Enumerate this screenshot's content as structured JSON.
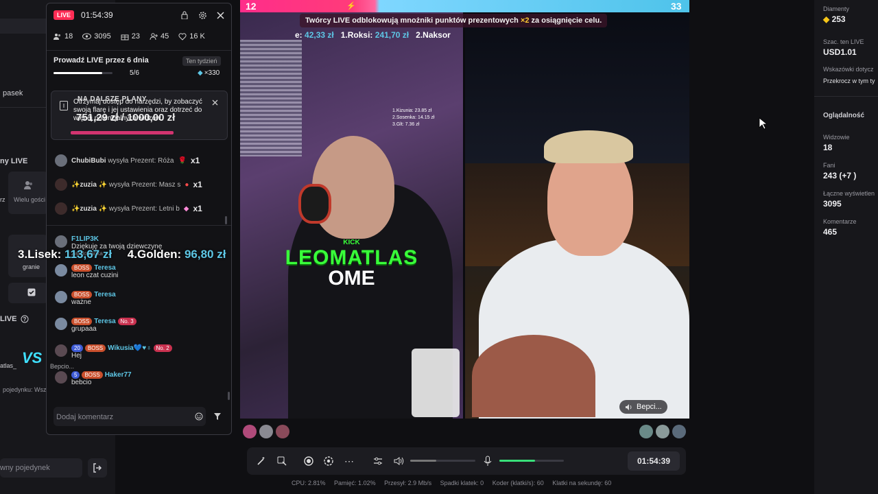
{
  "studio_left": {
    "label_pasek": "pasek",
    "label_live_small": "ny LIVE",
    "label_rz": "rz",
    "label_multi_guest": "Wielu gości",
    "label_granie": "granie",
    "label_live": "LIVE",
    "vs_name": "atlas_",
    "battle_gifts": "pojedynku: Wszystkie Prezenty",
    "battle_input": "wny pojedynek"
  },
  "chat": {
    "live_badge": "LIVE",
    "timer": "01:54:39",
    "stats": {
      "gifters": "18",
      "viewers": "3095",
      "gifts": "23",
      "followers": "45",
      "likes": "16 K"
    },
    "goal_title": "Prowadź LIVE przez 6 dnia",
    "goal_period": "Ten tydzień",
    "goal_progress_text": "5/6",
    "goal_progress": 0.83,
    "goal_reward": "×330",
    "notice_text": "Otrzymaj dostęp do narzędzi, by zobaczyć swoją flarę i jej ustawienia oraz dotrzeć do więcej potencjalnych widzów.",
    "overlay_plans": "NA DALSZE PLANY",
    "overlay_amount": "751,29 zł / 1000,00 zł",
    "messages": [
      {
        "user": "ChubiBubi",
        "text": "wysyła Prezent: Róża",
        "count": "x1"
      },
      {
        "user": "✨zuzia ✨",
        "text": "wysyła Prezent: Masz s",
        "count": "x1"
      },
      {
        "user": "✨zuzia ✨",
        "text": "wysyła Prezent: Letni b",
        "count": "x1"
      },
      {
        "user": "F1LIP3K",
        "text": "Dziękuję za twoją dziewczynę",
        "sub": "Zaadowanka"
      },
      {
        "user": "Teresa",
        "badge": "BOSS",
        "text": "leon czat cuzini"
      },
      {
        "user": "Teresa",
        "badge": "BOSS",
        "text": "ważne"
      },
      {
        "user": "Teresa",
        "badge": "BOSS",
        "rank": "No. 3",
        "text": "grupaaa"
      },
      {
        "user": "Wikusia💙♥︎♁",
        "level": "20",
        "badge": "BOSS",
        "rank": "No. 2",
        "text": "Hej"
      },
      {
        "user": "Haker77",
        "level": "5",
        "badge": "BOSS",
        "text": "bebcio",
        "sub": "Bepcio..."
      }
    ],
    "input_placeholder": "Dodaj komentarz"
  },
  "leaderboard_overlay": {
    "third_label": "3.Lisek:",
    "third_value": "113,67 zł",
    "fourth_label": "4.Golden:",
    "fourth_value": "96,80 zł"
  },
  "video": {
    "score_left": "12",
    "score_right": "33",
    "banner": "Twórcy LIVE odblokowują mnożniki punktów prezentowych",
    "banner_mult": "×2",
    "banner_end": "za osiągnięcie celu.",
    "ranking_line": {
      "a": "e:",
      "a_val": "42,33 zł",
      "b": "1.Roksi:",
      "b_val": "241,70 zł",
      "c": "2.Naksor"
    },
    "mini_rank": [
      "1.Kizunia: 23.85 zł",
      "2.Sosenka: 14.15 zł",
      "3.Glt: 7.36 zł"
    ],
    "kick_label": "KICK",
    "kick_name": "LEOMATLAS",
    "kick_sub": "OME",
    "guest_name": "Bepci..."
  },
  "controls": {
    "timer": "01:54:39",
    "volume": 0.4,
    "mic": 0.55
  },
  "status": {
    "cpu": "CPU: 2.81%",
    "memory": "Pamięć: 1.02%",
    "bitrate": "Przesył: 2.9 Mb/s",
    "dropped": "Spadki klatek: 0",
    "encoder": "Koder (klatki/s): 60",
    "fps": "Klatki na sekundę: 60"
  },
  "right_panel": {
    "diamonds_label": "Diamenty",
    "diamonds": "253",
    "est_label": "Szac. ten LIVE",
    "est": "USD1.01",
    "tips_label": "Wskazówki dotycz",
    "tips_text": "Przekrocz w tym ty",
    "viewership_title": "Oglądalność",
    "viewers_label": "Widzowie",
    "viewers": "18",
    "fans_label": "Fani",
    "fans": "243 (+7 )",
    "total_views_label": "Łączne wyświetlen",
    "total_views": "3095",
    "comments_label": "Komentarze",
    "comments": "465"
  },
  "colors": {
    "accent": "#ff2d55",
    "cyan": "#5ec7e6",
    "green": "#39ff3a"
  }
}
